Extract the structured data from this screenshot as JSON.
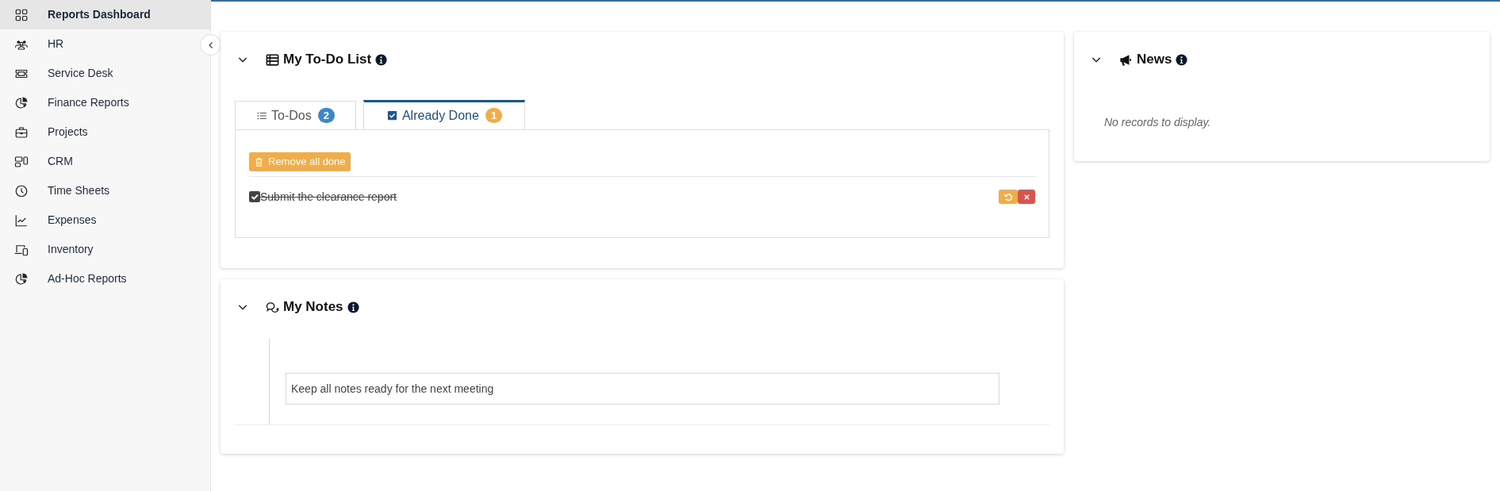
{
  "sidebar": {
    "items": [
      {
        "label": "Reports Dashboard",
        "kind": "grid",
        "selected": true
      },
      {
        "label": "HR",
        "kind": "people",
        "selected": false
      },
      {
        "label": "Service Desk",
        "kind": "ticket",
        "selected": false
      },
      {
        "label": "Finance Reports",
        "kind": "pie",
        "selected": false
      },
      {
        "label": "Projects",
        "kind": "briefcase",
        "selected": false
      },
      {
        "label": "CRM",
        "kind": "crm",
        "selected": false
      },
      {
        "label": "Time Sheets",
        "kind": "clock",
        "selected": false
      },
      {
        "label": "Expenses",
        "kind": "chart",
        "selected": false
      },
      {
        "label": "Inventory",
        "kind": "devices",
        "selected": false
      },
      {
        "label": "Ad-Hoc Reports",
        "kind": "pie",
        "selected": false
      }
    ]
  },
  "todo": {
    "title": "My To-Do List",
    "expanded": true,
    "tabs": [
      {
        "label": "To-Dos",
        "count": "2",
        "selected": false
      },
      {
        "label": "Already Done",
        "count": "1",
        "selected": true
      }
    ],
    "remove_button": "Remove all done",
    "items": [
      {
        "text": "Submit the clearance report",
        "checked": true
      }
    ]
  },
  "notes": {
    "title": "My Notes",
    "expanded": true,
    "input_value": "Keep all notes ready for the next meeting"
  },
  "news": {
    "title": "News",
    "expanded": true,
    "empty_text": "No records to display."
  }
}
